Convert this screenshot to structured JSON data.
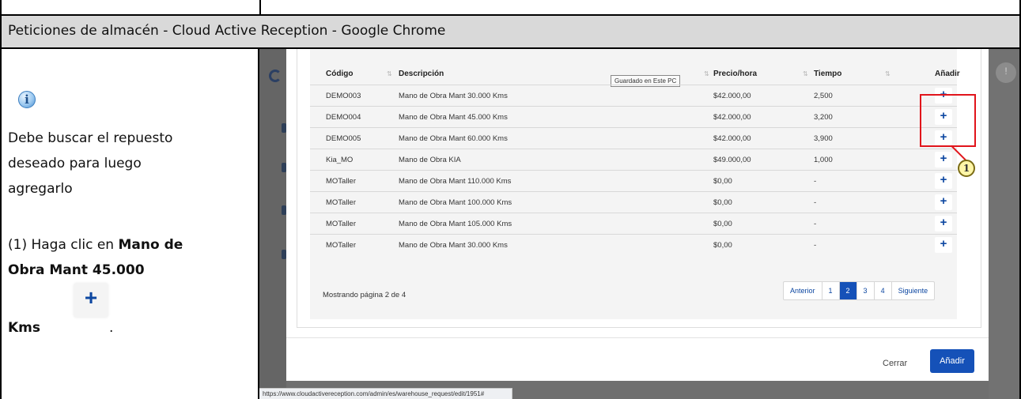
{
  "window": {
    "title": "Peticiones de almacén - Cloud Active Reception - Google Chrome"
  },
  "instructions": {
    "icon": "info-icon",
    "line1": "Debe buscar el repuesto",
    "line2": "deseado para luego",
    "line3": "agregarlo",
    "step_prefix": "(1) Haga clic en ",
    "step_bold_1": "Mano de",
    "step_bold_2": "Obra Mant 45.000",
    "step_bold_3": "Kms",
    "step_suffix": ".",
    "plus_glyph": "+"
  },
  "table": {
    "headers": {
      "code": "Código",
      "description": "Descripción",
      "price": "Precio/hora",
      "time": "Tiempo",
      "add": "Añadir"
    },
    "sort_glyph": "⇅",
    "tooltip": "Guardado en Este PC",
    "add_glyph": "+",
    "rows": [
      {
        "code": "DEMO003",
        "description": "Mano de Obra Mant 30.000 Kms",
        "price": "$42.000,00",
        "time": "2,500"
      },
      {
        "code": "DEMO004",
        "description": "Mano de Obra Mant 45.000 Kms",
        "price": "$42.000,00",
        "time": "3,200"
      },
      {
        "code": "DEMO005",
        "description": "Mano de Obra Mant 60.000 Kms",
        "price": "$42.000,00",
        "time": "3,900"
      },
      {
        "code": "Kia_MO",
        "description": "Mano de Obra KIA",
        "price": "$49.000,00",
        "time": "1,000"
      },
      {
        "code": "MOTaller",
        "description": "Mano de Obra Mant 110.000 Kms",
        "price": "$0,00",
        "time": "-"
      },
      {
        "code": "MOTaller",
        "description": "Mano de Obra Mant 100.000 Kms",
        "price": "$0,00",
        "time": "-"
      },
      {
        "code": "MOTaller",
        "description": "Mano de Obra Mant 105.000 Kms",
        "price": "$0,00",
        "time": "-"
      },
      {
        "code": "MOTaller",
        "description": "Mano de Obra Mant 30.000 Kms",
        "price": "$0,00",
        "time": "-"
      }
    ],
    "footer": "Mostrando página 2 de 4"
  },
  "pagination": {
    "prev": "Anterior",
    "pages": [
      "1",
      "2",
      "3",
      "4"
    ],
    "active": "2",
    "next": "Siguiente"
  },
  "modal": {
    "close_label": "Cerrar",
    "add_label": "Añadir"
  },
  "status_bar": {
    "url": "https://www.cloudactivereception.com/admin/es/warehouse_request/edit/1951#"
  },
  "callout": {
    "number": "1",
    "color": "#e1141b"
  },
  "colors": {
    "accent": "#1551b8",
    "title_bar": "#d9d9d9"
  }
}
